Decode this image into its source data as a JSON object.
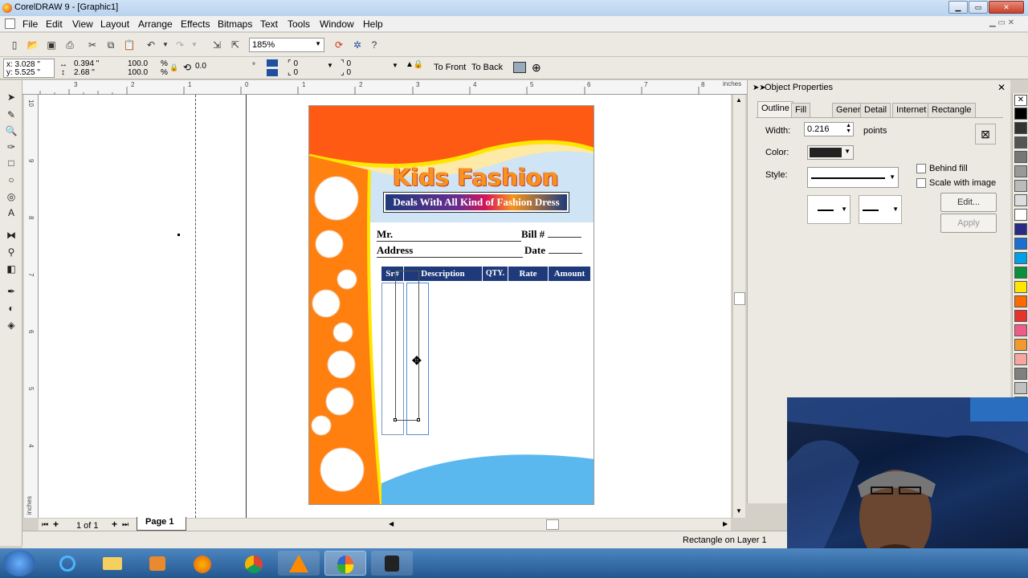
{
  "window": {
    "title": "CorelDRAW 9 - [Graphic1]"
  },
  "menu": [
    "File",
    "Edit",
    "View",
    "Layout",
    "Arrange",
    "Effects",
    "Bitmaps",
    "Text",
    "Tools",
    "Window",
    "Help"
  ],
  "toolbar": {
    "zoom": "185%"
  },
  "propbar": {
    "x": "x: 3.028 \"",
    "y": "y: 5.525 \"",
    "w": "0.394 \"",
    "h": "2.68 \"",
    "scale_x": "100.0",
    "scale_y": "100.0",
    "pct": "%",
    "rotation": "0.0",
    "corner_a": "0",
    "corner_b": "0",
    "corner_c": "0",
    "corner_d": "0",
    "to_front": "To Front",
    "to_back": "To Back"
  },
  "ruler": {
    "unit": "inches",
    "h_labels": [
      "3",
      "2",
      "1",
      "0",
      "1",
      "2",
      "3",
      "4",
      "5",
      "6",
      "7",
      "8"
    ],
    "v_labels": [
      "10",
      "9",
      "8",
      "7",
      "6",
      "5",
      "4"
    ],
    "v_unit": "inches"
  },
  "document": {
    "brand": "Kids Fashion",
    "tagline": "Deals With All Kind of Fashion Dress",
    "field_mr": "Mr.",
    "field_bill": "Bill #",
    "field_address": "Address",
    "field_date": "Date",
    "columns": [
      "Sr#",
      "Description",
      "QTY.",
      "Rate",
      "Amount"
    ]
  },
  "page_nav": {
    "count": "1 of 1",
    "tab": "Page 1"
  },
  "status": {
    "text": "Rectangle on Layer 1"
  },
  "docker": {
    "title": "Object Properties",
    "tabs": [
      "Outline",
      "Fill",
      "General",
      "Detail",
      "Internet",
      "Rectangle"
    ],
    "width_label": "Width:",
    "width_value": "0.216",
    "width_unit": "points",
    "color_label": "Color:",
    "style_label": "Style:",
    "behind_fill": "Behind fill",
    "scale_with_image": "Scale with image",
    "edit_btn": "Edit...",
    "apply_btn": "Apply"
  },
  "colors": {
    "doc_orange": "#ff6a13",
    "doc_blue": "#5bb8ee",
    "header_blue": "#1f3a7a",
    "selection": "#4a8fd6"
  },
  "palette": [
    "#000000",
    "#333333",
    "#555555",
    "#777777",
    "#999999",
    "#bbbbbb",
    "#dddddd",
    "#ffffff",
    "#2b2a85",
    "#1b6fd0",
    "#00a0e8",
    "#0a8f3c",
    "#ffe600",
    "#ff6a00",
    "#e8332d",
    "#ee5c8a",
    "#f39a2f",
    "#f7a7a0",
    "#808080",
    "#c0c0c0",
    "#e0c9e6"
  ]
}
